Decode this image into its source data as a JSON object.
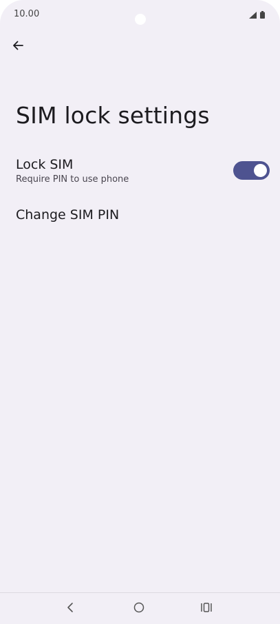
{
  "status_bar": {
    "time": "10.00",
    "icons": [
      "signal-icon",
      "battery-icon"
    ]
  },
  "header": {
    "back_icon": "arrow-back-icon",
    "title": "SIM lock settings"
  },
  "settings": {
    "lock_sim": {
      "title": "Lock SIM",
      "subtitle": "Require PIN to use phone",
      "toggle_on": true
    },
    "change_pin": {
      "title": "Change SIM PIN"
    }
  },
  "nav_bar": {
    "buttons": [
      "back-nav-icon",
      "home-icon",
      "recents-icon"
    ]
  },
  "colors": {
    "background": "#f2eff6",
    "toggle_on": "#4e5390",
    "text_primary": "#1c1b1f",
    "text_secondary": "#49454f"
  }
}
